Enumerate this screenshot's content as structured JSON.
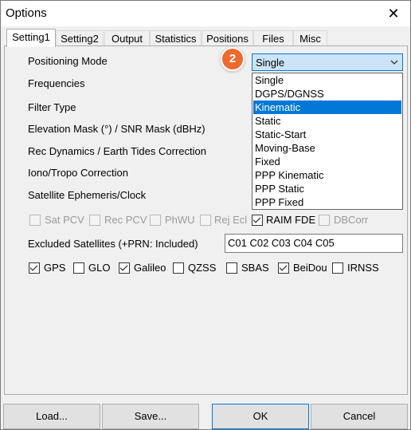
{
  "window": {
    "title": "Options"
  },
  "tabs": [
    "Setting1",
    "Setting2",
    "Output",
    "Statistics",
    "Positions",
    "Files",
    "Misc"
  ],
  "labels": {
    "positioning_mode": "Positioning Mode",
    "frequencies": "Frequencies",
    "filter_type": "Filter Type",
    "elevation_mask": "Elevation Mask (°) / SNR Mask (dBHz)",
    "rec_dynamics": "Rec Dynamics / Earth Tides Correction",
    "iono_tropo": "Iono/Tropo Correction",
    "ephemeris": "Satellite Ephemeris/Clock",
    "excluded_sats": "Excluded Satellites (+PRN: Included)"
  },
  "positioning_mode": {
    "value": "Single",
    "options": [
      "Single",
      "DGPS/DGNSS",
      "Kinematic",
      "Static",
      "Static-Start",
      "Moving-Base",
      "Fixed",
      "PPP Kinematic",
      "PPP Static",
      "PPP Fixed"
    ],
    "highlighted": "Kinematic"
  },
  "step_badge": "2",
  "option_checks": [
    {
      "label": "Sat PCV",
      "checked": false,
      "enabled": false
    },
    {
      "label": "Rec PCV",
      "checked": false,
      "enabled": false
    },
    {
      "label": "PhWU",
      "checked": false,
      "enabled": false
    },
    {
      "label": "Rej Ecl",
      "checked": false,
      "enabled": false
    },
    {
      "label": "RAIM FDE",
      "checked": true,
      "enabled": true
    },
    {
      "label": "DBCorr",
      "checked": false,
      "enabled": false
    }
  ],
  "excluded_satellites": "C01 C02 C03 C04 C05",
  "systems": [
    {
      "label": "GPS",
      "checked": true
    },
    {
      "label": "GLO",
      "checked": false
    },
    {
      "label": "Galileo",
      "checked": true
    },
    {
      "label": "QZSS",
      "checked": false
    },
    {
      "label": "SBAS",
      "checked": false
    },
    {
      "label": "BeiDou",
      "checked": true
    },
    {
      "label": "IRNSS",
      "checked": false
    }
  ],
  "buttons": {
    "load": "Load...",
    "save": "Save...",
    "ok": "OK",
    "cancel": "Cancel"
  }
}
